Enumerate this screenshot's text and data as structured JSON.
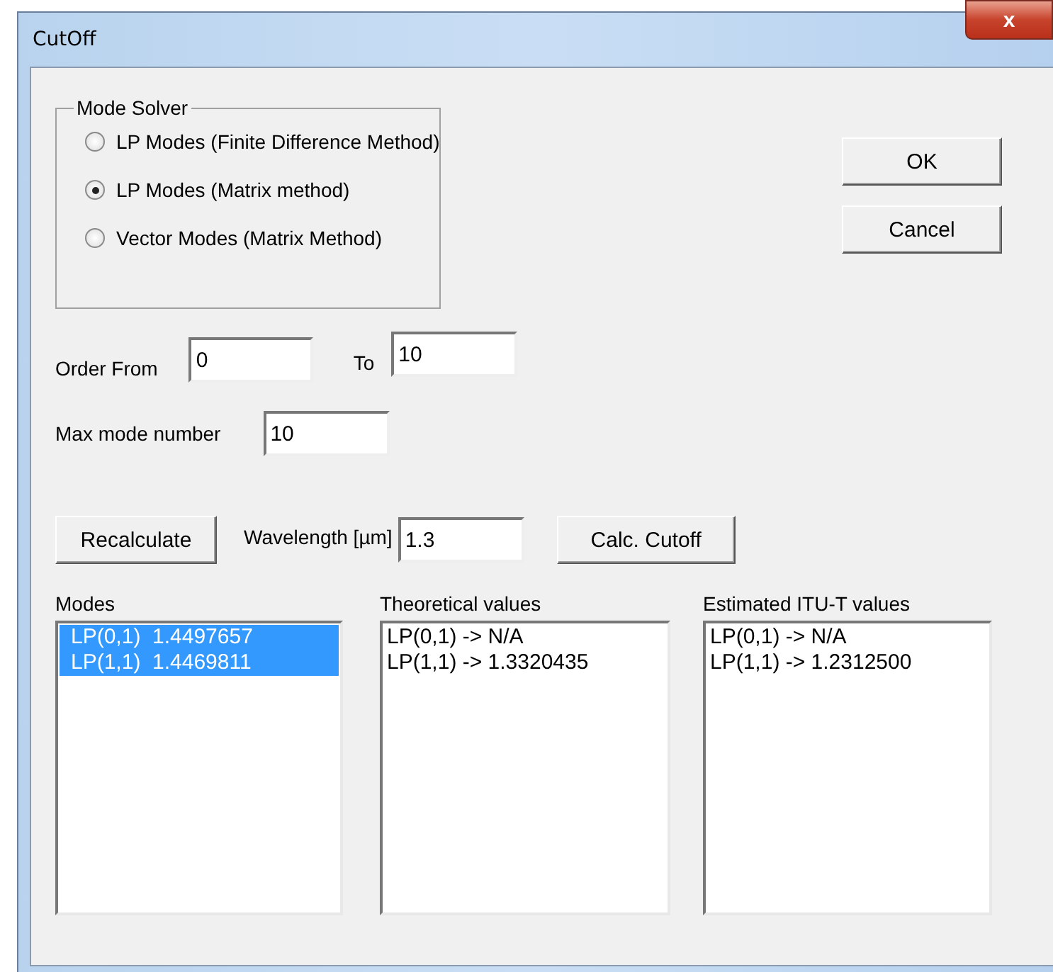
{
  "window": {
    "title": "CutOff",
    "close_label": "x"
  },
  "mode_solver": {
    "title": "Mode Solver",
    "options": [
      {
        "label": "LP Modes (Finite Difference Method)",
        "selected": false
      },
      {
        "label": "LP Modes (Matrix method)",
        "selected": true
      },
      {
        "label": "Vector Modes (Matrix Method)",
        "selected": false
      }
    ]
  },
  "buttons": {
    "ok": "OK",
    "cancel": "Cancel"
  },
  "order": {
    "from_label": "Order From",
    "from_value": "0",
    "to_label": "To",
    "to_value": "10"
  },
  "max_mode": {
    "label": "Max mode number",
    "value": "10"
  },
  "recalculate": "Recalculate",
  "wavelength": {
    "label": "Wavelength [µm]",
    "value": "1.3"
  },
  "calc_cutoff": "Calc. Cutoff",
  "lists": [
    {
      "title": "Modes",
      "items": [
        {
          "text": "LP(0,1)  1.4497657",
          "selected": true
        },
        {
          "text": "LP(1,1)  1.4469811",
          "selected": true
        }
      ]
    },
    {
      "title": "Theoretical values",
      "items": [
        {
          "text": "LP(0,1) -> N/A",
          "selected": false
        },
        {
          "text": "LP(1,1) -> 1.3320435",
          "selected": false
        }
      ]
    },
    {
      "title": "Estimated ITU-T values",
      "items": [
        {
          "text": "LP(0,1) -> N/A",
          "selected": false
        },
        {
          "text": "LP(1,1) -> 1.2312500",
          "selected": false
        }
      ]
    }
  ]
}
